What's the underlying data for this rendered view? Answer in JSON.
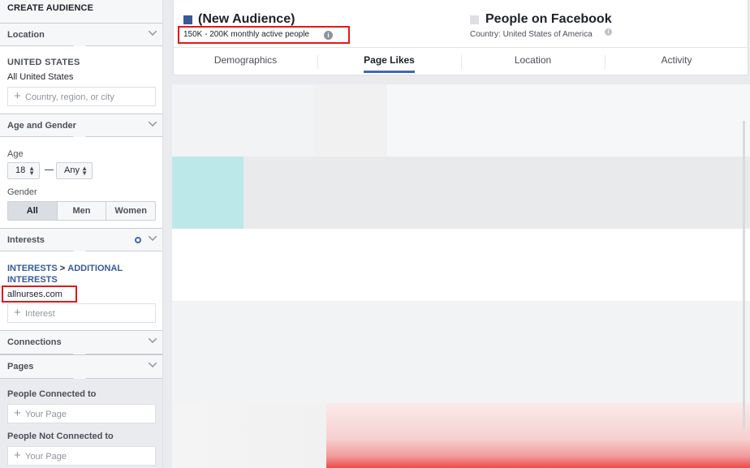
{
  "sidebar": {
    "title": "CREATE AUDIENCE",
    "location": {
      "heading": "Location",
      "country": "UNITED STATES",
      "scope": "All United States",
      "input_placeholder": "Country, region, or city"
    },
    "age_gender": {
      "heading": "Age and Gender",
      "age_label": "Age",
      "age_min": "18",
      "age_max": "Any",
      "gender_label": "Gender",
      "gender_options": [
        "All",
        "Men",
        "Women"
      ]
    },
    "interests": {
      "heading": "Interests",
      "path_1": "INTERESTS",
      "path_sep": ">",
      "path_2": "ADDITIONAL INTERESTS",
      "selected": "allnurses.com",
      "input_placeholder": "Interest"
    },
    "connections": {
      "heading": "Connections"
    },
    "pages": {
      "heading": "Pages",
      "connected_label": "People Connected to",
      "connected_placeholder": "Your Page",
      "not_connected_label": "People Not Connected to",
      "not_connected_placeholder": "Your Page"
    }
  },
  "header": {
    "audience_title": "(New Audience)",
    "audience_size": "150K - 200K monthly active people",
    "audience_color": "#3b5998",
    "facebook_title": "People on Facebook",
    "facebook_country": "Country: United States of America",
    "facebook_color": "#dddfe2"
  },
  "tabs": [
    "Demographics",
    "Page Likes",
    "Location",
    "Activity"
  ],
  "active_tab": "Page Likes",
  "highlight_color": "#e0191a"
}
